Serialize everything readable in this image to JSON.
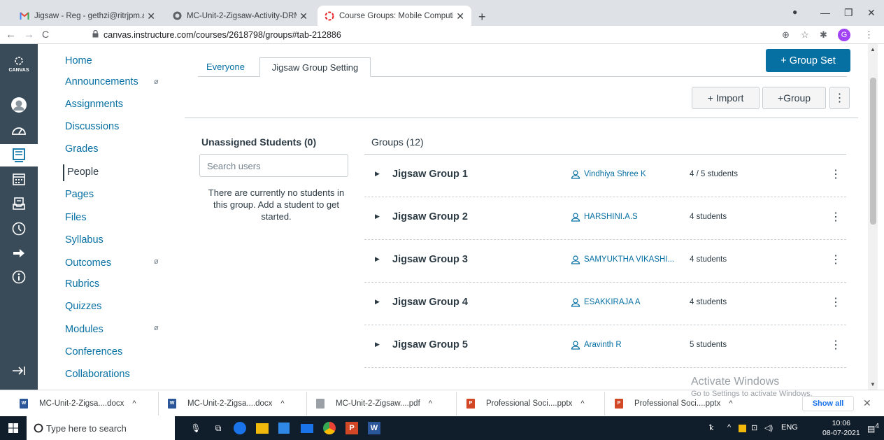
{
  "browser": {
    "tabs": [
      {
        "label": "Jigsaw - Reg - gethzi@ritrjpm.ac",
        "icon": "gmail-icon",
        "active": false
      },
      {
        "label": "MC-Unit-2-Zigsaw-Activity-DRM",
        "icon": "web-icon",
        "active": false
      },
      {
        "label": "Course Groups: Mobile Computi",
        "icon": "canvas-icon",
        "active": true
      }
    ],
    "url": "canvas.instructure.com/courses/2618798/groups#tab-212886",
    "profile_initial": "G"
  },
  "global_nav": {
    "logo_text": "CANVAS",
    "items": [
      "account-icon",
      "dashboard-icon",
      "courses-icon",
      "calendar-icon",
      "inbox-icon",
      "history-icon",
      "commons-icon",
      "help-icon"
    ],
    "collapse": "collapse-icon"
  },
  "course_nav": {
    "items": [
      {
        "label": "Home",
        "hidden": false
      },
      {
        "label": "Announcements",
        "hidden": true
      },
      {
        "label": "Assignments",
        "hidden": false
      },
      {
        "label": "Discussions",
        "hidden": false
      },
      {
        "label": "Grades",
        "hidden": false
      },
      {
        "label": "People",
        "hidden": false,
        "active": true
      },
      {
        "label": "Pages",
        "hidden": false
      },
      {
        "label": "Files",
        "hidden": false
      },
      {
        "label": "Syllabus",
        "hidden": false
      },
      {
        "label": "Outcomes",
        "hidden": true
      },
      {
        "label": "Rubrics",
        "hidden": false
      },
      {
        "label": "Quizzes",
        "hidden": false
      },
      {
        "label": "Modules",
        "hidden": true
      },
      {
        "label": "Conferences",
        "hidden": false
      },
      {
        "label": "Collaborations",
        "hidden": false
      }
    ]
  },
  "main": {
    "tabs": [
      {
        "label": "Everyone"
      },
      {
        "label": "Jigsaw Group Setting",
        "active": true
      }
    ],
    "group_set_button": "+ Group Set",
    "import_button": "+ Import",
    "group_button": "+Group",
    "unassigned": {
      "header": "Unassigned Students (0)",
      "search_placeholder": "Search users",
      "empty_text": "There are currently no students in this group. Add a student to get started."
    },
    "groups_header": "Groups (12)",
    "groups": [
      {
        "name": "Jigsaw Group 1",
        "leader": "Vindhiya Shree K",
        "count": "4 / 5 students"
      },
      {
        "name": "Jigsaw Group 2",
        "leader": "HARSHINI.A.S",
        "count": "4 students"
      },
      {
        "name": "Jigsaw Group 3",
        "leader": "SAMYUKTHA VIKASHI...",
        "count": "4 students"
      },
      {
        "name": "Jigsaw Group 4",
        "leader": "ESAKKIRAJA A",
        "count": "4 students"
      },
      {
        "name": "Jigsaw Group 5",
        "leader": "Aravinth R",
        "count": "5 students"
      }
    ],
    "watermark_title": "Activate Windows",
    "watermark_sub": "Go to Settings to activate Windows."
  },
  "downloads": {
    "items": [
      {
        "name": "MC-Unit-2-Zigsa....docx",
        "type": "docx"
      },
      {
        "name": "MC-Unit-2-Zigsa....docx",
        "type": "docx"
      },
      {
        "name": "MC-Unit-2-Zigsaw....pdf",
        "type": "pdf"
      },
      {
        "name": "Professional Soci....pptx",
        "type": "pptx"
      },
      {
        "name": "Professional Soci....pptx",
        "type": "pptx"
      }
    ],
    "show_all": "Show all"
  },
  "taskbar": {
    "search_placeholder": "Type here to search",
    "language": "ENG",
    "time": "10:06",
    "date": "08-07-2021",
    "notification_count": "4"
  },
  "colors": {
    "link": "#0770a3",
    "primary": "#0770a3",
    "global_nav": "#394b58",
    "taskbar": "#101d2b"
  }
}
